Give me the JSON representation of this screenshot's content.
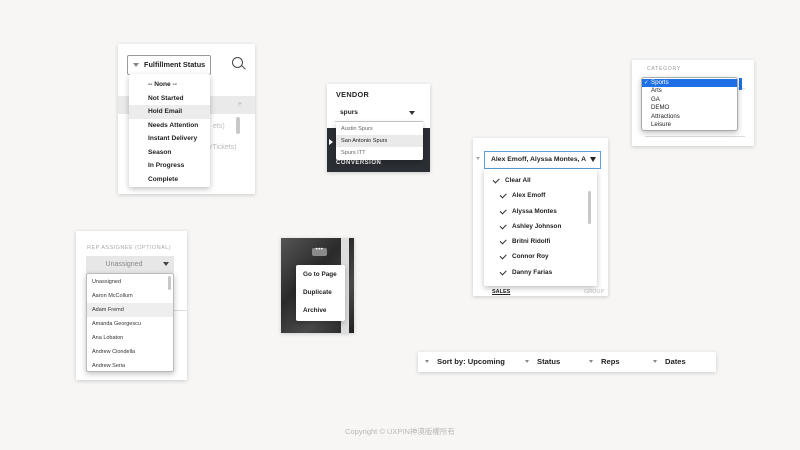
{
  "fulfillment": {
    "label": "Fulfillment Status",
    "options": [
      "-- None --",
      "Not Started",
      "Hold Email",
      "Needs Attention",
      "Instant Delivery",
      "Season",
      "In Progress",
      "Complete"
    ],
    "highlighted": "Hold Email",
    "bg_fragments": [
      "ets)",
      "rTickets)"
    ]
  },
  "vendor": {
    "label": "VENDOR",
    "value": "spurs",
    "options": [
      "Austin Spurs",
      "San Antonio Spurs",
      "Spurs ITT"
    ],
    "highlighted": "San Antonio Spurs",
    "footer": "CONVERSION"
  },
  "category": {
    "label": "CATEGORY",
    "options": [
      "Sports",
      "Arts",
      "GA",
      "DEMO",
      "Attractions",
      "Leisure"
    ],
    "selected": "Sports"
  },
  "assignees": {
    "value": "Alex Emoff, Alyssa Montes, A",
    "clear_all": "Clear All",
    "users": [
      "Alex Emoff",
      "Alyssa Montes",
      "Ashley Johnson",
      "Britni Ridolfi",
      "Connor Roy",
      "Danny Farias"
    ],
    "tab_sales": "SALES",
    "tab_group": "GROUP"
  },
  "rep_assignee": {
    "label": "REP ASSIGNEE (OPTIONAL)",
    "placeholder": "Unassigned",
    "options": [
      "Unassigned",
      "Aaron McCollum",
      "Adam Fremd",
      "Amanda Georgescu",
      "Ana Lobaton",
      "Andrew Ciondella",
      "Andrew Seria"
    ],
    "highlighted": "Adam Fremd"
  },
  "context_menu": {
    "trigger": "•••",
    "options": [
      "Go to Page",
      "Duplicate",
      "Archive"
    ]
  },
  "filter_bar": {
    "sort": "Sort by: Upcoming",
    "status": "Status",
    "reps": "Reps",
    "dates": "Dates"
  },
  "copyright": "Copyright © UXPIN神漠版權所有"
}
